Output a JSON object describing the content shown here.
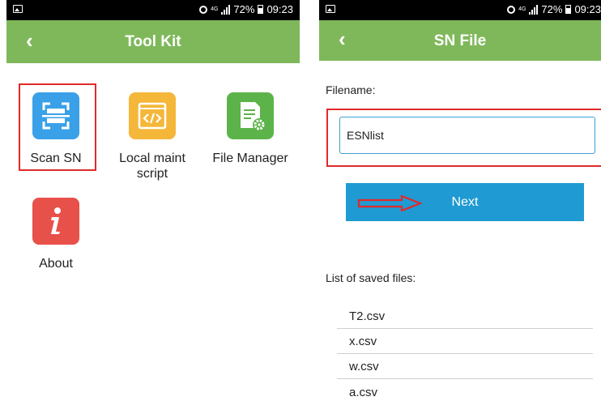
{
  "status": {
    "network": "4G",
    "battery": "72%",
    "time": "09:23"
  },
  "left": {
    "title": "Tool Kit",
    "back_glyph": "‹",
    "tiles": [
      {
        "label": "Scan SN",
        "icon": "scan-icon",
        "color": "#3aa0e8"
      },
      {
        "label": "Local maint script",
        "icon": "code-window-icon",
        "color": "#f4b73a"
      },
      {
        "label": "File Manager",
        "icon": "file-settings-icon",
        "color": "#5cb34a"
      },
      {
        "label": "About",
        "icon": "info-icon",
        "color": "#e8504a"
      }
    ]
  },
  "right": {
    "title": "SN File",
    "back_glyph": "‹",
    "filename_label": "Filename:",
    "filename_value": "ESNlist",
    "next_label": "Next",
    "saved_label": "List of saved files:",
    "files": [
      "T2.csv",
      "x.csv",
      "w.csv",
      "a.csv"
    ]
  },
  "colors": {
    "appbar": "#7fb85a",
    "button": "#1f9ad2",
    "highlight": "#e02a2a"
  }
}
